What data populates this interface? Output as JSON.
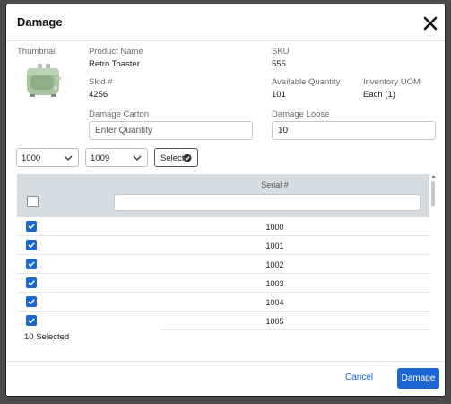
{
  "modal": {
    "title": "Damage"
  },
  "product": {
    "thumbnail_label": "Thumbnail",
    "name_label": "Product Name",
    "name_value": "Retro Toaster",
    "sku_label": "SKU",
    "sku_value": "555",
    "skid_label": "Skid #",
    "skid_value": "4256",
    "available_label": "Available Quantity",
    "available_value": "101",
    "uom_label": "Inventory UOM",
    "uom_value": "Each (1)"
  },
  "damage": {
    "carton_label": "Damage Carton",
    "carton_placeholder": "Enter Quantity",
    "loose_label": "Damage Loose",
    "loose_value": "10"
  },
  "range": {
    "from_value": "1000",
    "to_value": "1009",
    "select_label": "Select"
  },
  "table": {
    "column_header": "Serial #",
    "rows": [
      "1000",
      "1001",
      "1002",
      "1003",
      "1004",
      "1005"
    ]
  },
  "selected_count_text": "10 Selected",
  "footer": {
    "cancel_label": "Cancel",
    "damage_label": "Damage"
  },
  "colors": {
    "accent": "#1b66d2",
    "table_header": "#d5dde3"
  }
}
